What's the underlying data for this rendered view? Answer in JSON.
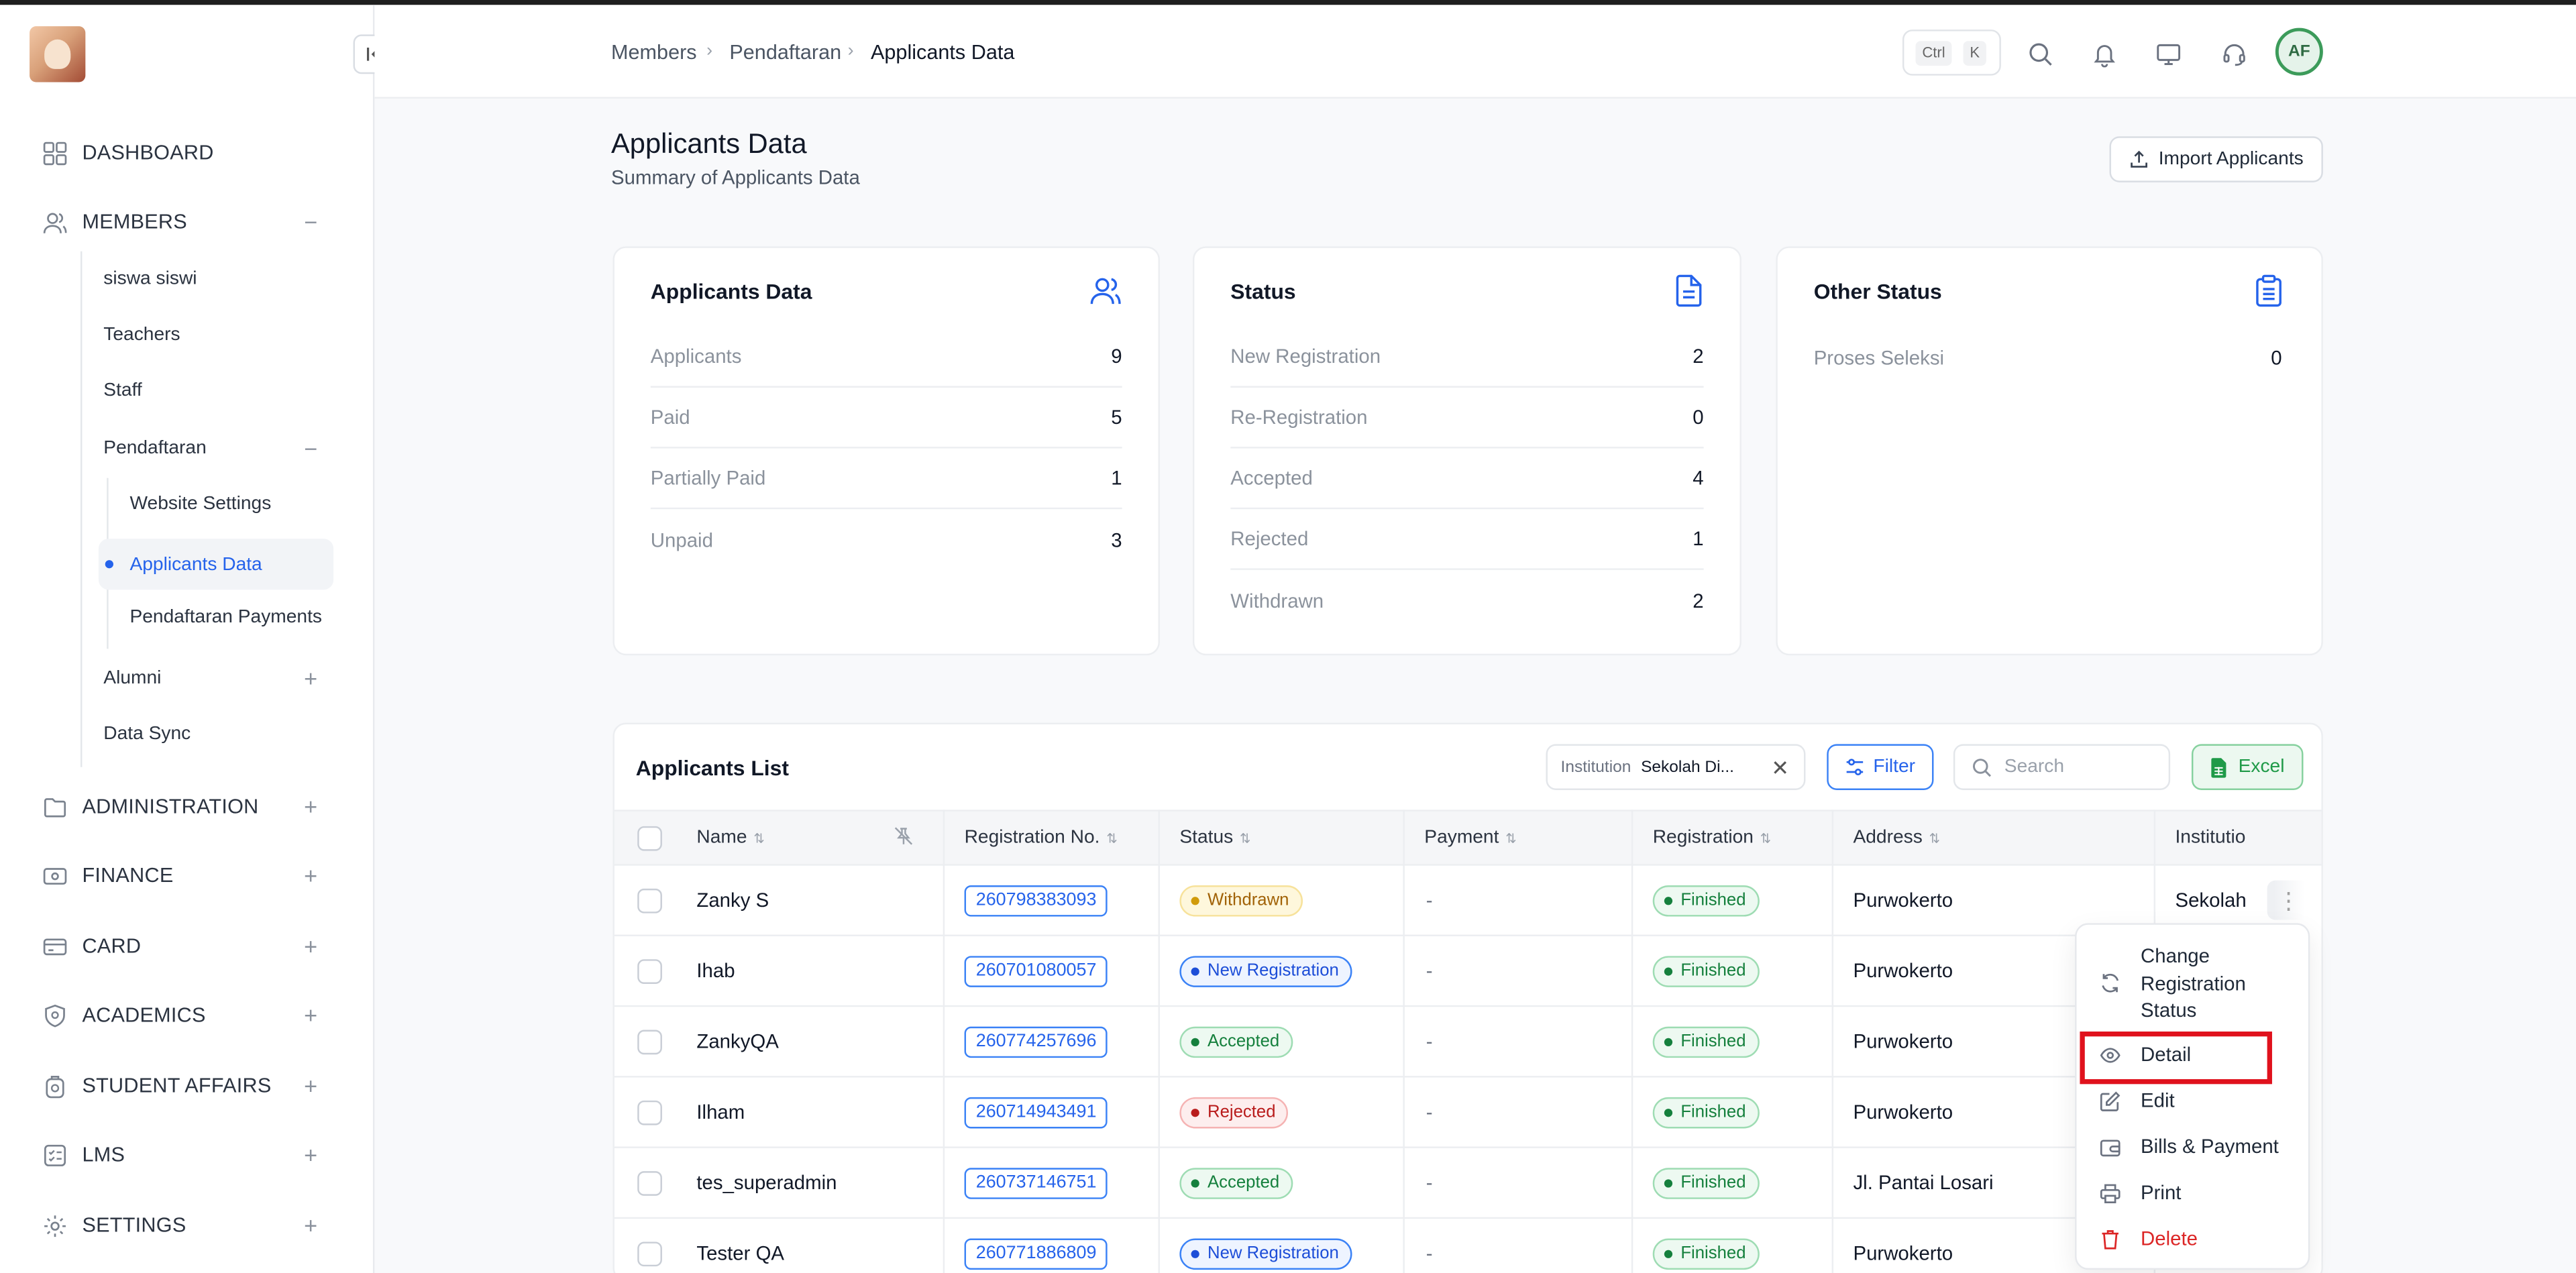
{
  "sidebar": {
    "collapse_icon": "collapse-left-icon",
    "items": [
      {
        "label": "DASHBOARD",
        "icon": "grid-icon",
        "toggle": ""
      },
      {
        "label": "MEMBERS",
        "icon": "users-icon",
        "toggle": "−"
      },
      {
        "label": "ADMINISTRATION",
        "icon": "folder-icon",
        "toggle": "+"
      },
      {
        "label": "FINANCE",
        "icon": "banknote-icon",
        "toggle": "+"
      },
      {
        "label": "CARD",
        "icon": "card-icon",
        "toggle": "+"
      },
      {
        "label": "ACADEMICS",
        "icon": "shield-icon",
        "toggle": "+"
      },
      {
        "label": "STUDENT AFFAIRS",
        "icon": "badge-icon",
        "toggle": "+"
      },
      {
        "label": "LMS",
        "icon": "checklist-icon",
        "toggle": "+"
      },
      {
        "label": "SETTINGS",
        "icon": "gear-icon",
        "toggle": "+"
      }
    ],
    "members_sub": [
      {
        "label": "siswa siswi"
      },
      {
        "label": "Teachers"
      },
      {
        "label": "Staff"
      },
      {
        "label": "Pendaftaran",
        "toggle": "−"
      },
      {
        "label": "Alumni",
        "toggle": "+"
      },
      {
        "label": "Data Sync"
      }
    ],
    "pendaftaran_sub": [
      {
        "label": "Website Settings"
      },
      {
        "label": "Applicants Data",
        "active": true
      },
      {
        "label": "Pendaftaran Payments"
      }
    ]
  },
  "header": {
    "breadcrumb": [
      "Members",
      "Pendaftaran",
      "Applicants Data"
    ],
    "shortcut_keys": [
      "Ctrl",
      "K"
    ],
    "avatar_initials": "AF"
  },
  "page": {
    "title": "Applicants Data",
    "subtitle": "Summary of Applicants Data",
    "import_label": "Import Applicants"
  },
  "cards": [
    {
      "title": "Applicants Data",
      "icon": "users-icon",
      "rows": [
        {
          "label": "Applicants",
          "value": "9"
        },
        {
          "label": "Paid",
          "value": "5"
        },
        {
          "label": "Partially Paid",
          "value": "1"
        },
        {
          "label": "Unpaid",
          "value": "3"
        }
      ]
    },
    {
      "title": "Status",
      "icon": "document-icon",
      "rows": [
        {
          "label": "New Registration",
          "value": "2"
        },
        {
          "label": "Re-Registration",
          "value": "0"
        },
        {
          "label": "Accepted",
          "value": "4"
        },
        {
          "label": "Rejected",
          "value": "1"
        },
        {
          "label": "Withdrawn",
          "value": "2"
        }
      ]
    },
    {
      "title": "Other Status",
      "icon": "clipboard-icon",
      "rows": [
        {
          "label": "Proses Seleksi",
          "value": "0"
        }
      ]
    }
  ],
  "list": {
    "title": "Applicants List",
    "institution_key": "Institution",
    "institution_value": "Sekolah Di...",
    "filter_label": "Filter",
    "search_placeholder": "Search",
    "excel_label": "Excel",
    "columns": [
      "Name",
      "Registration No.",
      "Status",
      "Payment",
      "Registration",
      "Address",
      "Institutio"
    ],
    "rows": [
      {
        "name": "Zanky S",
        "reg": "260798383093",
        "status": "Withdrawn",
        "status_kind": "withdrawn",
        "payment": "-",
        "registration": "Finished",
        "address": "Purwokerto",
        "institution": "Sekolah"
      },
      {
        "name": "Ihab",
        "reg": "260701080057",
        "status": "New Registration",
        "status_kind": "new",
        "payment": "-",
        "registration": "Finished",
        "address": "Purwokerto",
        "institution": ""
      },
      {
        "name": "ZankyQA",
        "reg": "260774257696",
        "status": "Accepted",
        "status_kind": "accepted",
        "payment": "-",
        "registration": "Finished",
        "address": "Purwokerto",
        "institution": ""
      },
      {
        "name": "Ilham",
        "reg": "260714943491",
        "status": "Rejected",
        "status_kind": "rejected",
        "payment": "-",
        "registration": "Finished",
        "address": "Purwokerto",
        "institution": ""
      },
      {
        "name": "tes_superadmin",
        "reg": "260737146751",
        "status": "Accepted",
        "status_kind": "accepted",
        "payment": "-",
        "registration": "Finished",
        "address": "Jl. Pantai Losari",
        "institution": ""
      },
      {
        "name": "Tester QA",
        "reg": "260771886809",
        "status": "New Registration",
        "status_kind": "new",
        "payment": "-",
        "registration": "Finished",
        "address": "Purwokerto",
        "institution": ""
      }
    ]
  },
  "row_menu": {
    "items": [
      {
        "label": "Change Registration Status",
        "icon": "refresh-icon"
      },
      {
        "label": "Detail",
        "icon": "eye-icon"
      },
      {
        "label": "Edit",
        "icon": "edit-icon"
      },
      {
        "label": "Bills & Payment",
        "icon": "wallet-icon"
      },
      {
        "label": "Print",
        "icon": "printer-icon"
      },
      {
        "label": "Delete",
        "icon": "trash-icon"
      }
    ]
  },
  "colors": {
    "accent": "#2563eb",
    "success": "#15803d",
    "danger": "#dc2626",
    "warning": "#a16207",
    "highlight_box": "#e0121d"
  }
}
